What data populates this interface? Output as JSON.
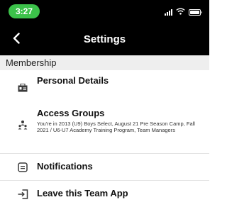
{
  "status_bar": {
    "time": "3:27",
    "icons": [
      "signal-icon",
      "wifi-icon",
      "battery-icon"
    ]
  },
  "nav": {
    "title": "Settings",
    "back_icon": "chevron-left-icon"
  },
  "section": {
    "title": "Membership"
  },
  "items": [
    {
      "label": "Personal Details",
      "icon": "id-card-icon"
    },
    {
      "label": "Access Groups",
      "icon": "people-icon",
      "subtitle": "You're in 2013 (U9) Boys Select, August 21 Pre Season Camp, Fall 2021 / U6-U7 Academy Training Program, Team Managers"
    },
    {
      "label": "Notifications",
      "icon": "message-icon"
    },
    {
      "label": "Leave this Team App",
      "icon": "exit-icon"
    }
  ],
  "colors": {
    "header_bg": "#000000",
    "time_pill": "#3cc24a",
    "section_bg": "#eeeeee"
  }
}
